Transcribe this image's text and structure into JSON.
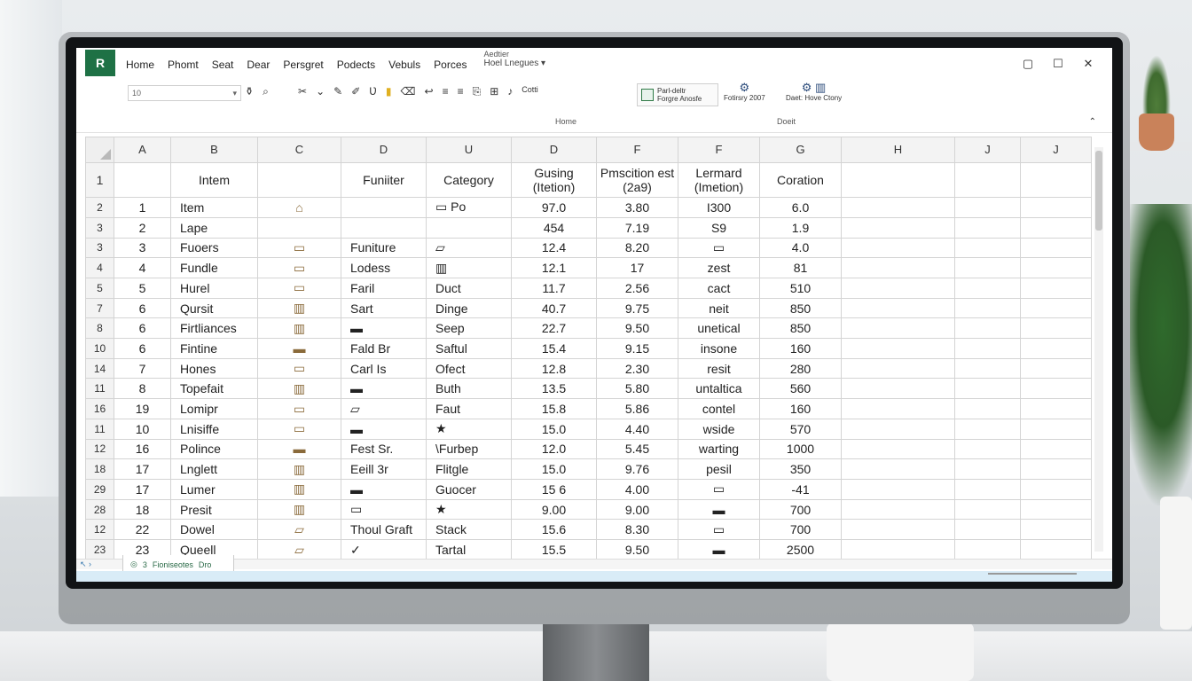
{
  "window": {
    "app_logo": "R",
    "tabs": [
      "Home",
      "Phomt",
      "Seat",
      "Dear",
      "Persgret",
      "Podects",
      "Vebuls",
      "Porces",
      "Hoel Lnegues"
    ],
    "doc_title": "Aedtier",
    "controls": {
      "restore": "▢",
      "maximize": "☐",
      "close": "✕"
    }
  },
  "ribbon": {
    "font_size_value": "10",
    "button_box_line1": "Parl-deltr",
    "button_box_line2": "Forgre Anosfe",
    "col1_line1": "Fotirsry 2007",
    "col2_line1": "Daet: Hove Ctony",
    "col3_label": "Cotti",
    "group_home": "Home",
    "group_doeit": "Doeit"
  },
  "columns": [
    "A",
    "B",
    "C",
    "D",
    "U",
    "D",
    "F",
    "F",
    "G",
    "H",
    "J",
    "J"
  ],
  "header_row": {
    "num": "1",
    "cells": [
      "",
      "Intem",
      "",
      "Funiiter",
      "Category",
      "Gusing (Itetion)",
      "Pmscition est (2a9)",
      "Lermard (Imetion)",
      "Coration",
      "",
      "",
      ""
    ]
  },
  "rows": [
    {
      "num": "2",
      "a": "1",
      "b": "Item",
      "c": "⌂",
      "d": "",
      "e": "▭ Po",
      "f": "97.0",
      "g": "3.80",
      "h": "I300",
      "i": "6.0"
    },
    {
      "num": "3",
      "a": "2",
      "b": "Lape",
      "c": "",
      "d": "",
      "e": "",
      "f": "454",
      "g": "7.19",
      "h": "S9",
      "i": "1.9"
    },
    {
      "num": "3",
      "a": "3",
      "b": "Fuoers",
      "c": "▭",
      "d": "Funiture",
      "e": "▱",
      "f": "12.4",
      "g": "8.20",
      "h": "▭",
      "i": "4.0"
    },
    {
      "num": "4",
      "a": "4",
      "b": "Fundle",
      "c": "▭",
      "d": "Lodess",
      "e": "▥",
      "f": "12.1",
      "g": "17",
      "h": "zest",
      "i": "81"
    },
    {
      "num": "5",
      "a": "5",
      "b": "Hurel",
      "c": "▭",
      "d": "Faril",
      "e": "Duct",
      "f": "11.7",
      "g": "2.56",
      "h": "cact",
      "i": "510"
    },
    {
      "num": "7",
      "a": "6",
      "b": "Qursit",
      "c": "▥",
      "d": "Sart",
      "e": "Dinge",
      "f": "40.7",
      "g": "9.75",
      "h": "neit",
      "i": "850"
    },
    {
      "num": "8",
      "a": "6",
      "b": "Firtliances",
      "c": "▥",
      "d": "▬",
      "e": "Seep",
      "f": "22.7",
      "g": "9.50",
      "h": "unetical",
      "i": "850"
    },
    {
      "num": "10",
      "a": "6",
      "b": "Fintine",
      "c": "▬",
      "d": "Fald Br",
      "e": "Saftul",
      "f": "15.4",
      "g": "9.15",
      "h": "insone",
      "i": "160"
    },
    {
      "num": "14",
      "a": "7",
      "b": "Hones",
      "c": "▭",
      "d": "Carl Is",
      "e": "Ofect",
      "f": "12.8",
      "g": "2.30",
      "h": "resit",
      "i": "280"
    },
    {
      "num": "11",
      "a": "8",
      "b": "Topefait",
      "c": "▥",
      "d": "▬",
      "e": "Buth",
      "f": "13.5",
      "g": "5.80",
      "h": "untaltica",
      "i": "560"
    },
    {
      "num": "16",
      "a": "19",
      "b": "Lomipr",
      "c": "▭",
      "d": "▱",
      "e": "Faut",
      "f": "15.8",
      "g": "5.86",
      "h": "contel",
      "i": "160"
    },
    {
      "num": "11",
      "a": "10",
      "b": "Lnisiffe",
      "c": "▭",
      "d": "▬",
      "e": "★",
      "f": "15.0",
      "g": "4.40",
      "h": "wside",
      "i": "570"
    },
    {
      "num": "12",
      "a": "16",
      "b": "Polince",
      "c": "▬",
      "d": "Fest Sr.",
      "e": "\\Furbep",
      "f": "12.0",
      "g": "5.45",
      "h": "warting",
      "i": "1000"
    },
    {
      "num": "18",
      "a": "17",
      "b": "Lnglett",
      "c": "▥",
      "d": "Eeill 3r",
      "e": "Flitgle",
      "f": "15.0",
      "g": "9.76",
      "h": "pesil",
      "i": "350"
    },
    {
      "num": "29",
      "a": "17",
      "b": "Lumer",
      "c": "▥",
      "d": "▬",
      "e": "Guocer",
      "f": "15 6",
      "g": "4.00",
      "h": "▭",
      "i": "-41"
    },
    {
      "num": "28",
      "a": "18",
      "b": "Presit",
      "c": "▥",
      "d": "▭",
      "e": "★",
      "f": "9.00",
      "g": "9.00",
      "h": "▬",
      "i": "700"
    },
    {
      "num": "12",
      "a": "22",
      "b": "Dowel",
      "c": "▱",
      "d": "Thoul Graft",
      "e": "Stack",
      "f": "15.6",
      "g": "8.30",
      "h": "▭",
      "i": "700"
    },
    {
      "num": "23",
      "a": "23",
      "b": "Queell",
      "c": "▱",
      "d": "✓",
      "e": "Tartal",
      "f": "15.5",
      "g": "9.50",
      "h": "▬",
      "i": "2500"
    }
  ],
  "sheet_tab": {
    "count": "3",
    "label": "Fioniseotes",
    "extra": "Dro"
  },
  "colors": {
    "accent": "#1e7145",
    "grid": "#d4d4d4",
    "status": "#d9ecf7"
  }
}
